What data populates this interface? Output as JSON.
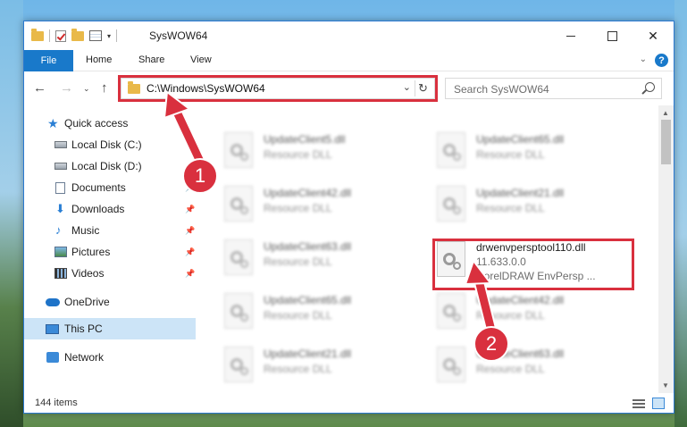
{
  "window": {
    "title": "SysWOW64",
    "minimize": "",
    "maximize": "",
    "close": "✕"
  },
  "ribbon": {
    "tabs": [
      "File",
      "Home",
      "Share",
      "View"
    ],
    "help": "?"
  },
  "nav": {
    "address": "C:\\Windows\\SysWOW64",
    "search_placeholder": "Search SysWOW64"
  },
  "sidebar": {
    "items": [
      {
        "label": "Quick access",
        "icon": "star-icon"
      },
      {
        "label": "Local Disk (C:)",
        "icon": "disk-icon"
      },
      {
        "label": "Local Disk (D:)",
        "icon": "disk-icon"
      },
      {
        "label": "Documents",
        "icon": "documents-icon"
      },
      {
        "label": "Downloads",
        "icon": "download-icon"
      },
      {
        "label": "Music",
        "icon": "music-icon"
      },
      {
        "label": "Pictures",
        "icon": "pictures-icon"
      },
      {
        "label": "Videos",
        "icon": "videos-icon"
      },
      {
        "label": "OneDrive",
        "icon": "cloud-icon"
      },
      {
        "label": "This PC",
        "icon": "computer-icon"
      },
      {
        "label": "Network",
        "icon": "network-icon"
      }
    ]
  },
  "files": [
    {
      "name": "UpdateClient5.dll",
      "type": "Resource DLL"
    },
    {
      "name": "UpdateClient65.dll",
      "type": "Resource DLL"
    },
    {
      "name": "UpdateClient42.dll",
      "type": "Resource DLL"
    },
    {
      "name": "UpdateClient21.dll",
      "type": "Resource DLL"
    },
    {
      "name": "UpdateClient63.dll",
      "type": "Resource DLL"
    },
    {
      "name": "drwenvpersptool110.dll",
      "version": "11.633.0.0",
      "type": "CorelDRAW EnvPersp ..."
    },
    {
      "name": "UpdateClient65.dll",
      "type": "Resource DLL"
    },
    {
      "name": "UpdateClient42.dll",
      "type": "Resource DLL"
    },
    {
      "name": "UpdateClient21.dll",
      "type": "Resource DLL"
    },
    {
      "name": "UpdateClient63.dll",
      "type": "Resource DLL"
    }
  ],
  "status": {
    "count": "144 items"
  },
  "callouts": [
    "1",
    "2"
  ],
  "colors": {
    "accent": "#1979ca",
    "highlight": "#d9303e",
    "selected": "#cce4f7"
  }
}
